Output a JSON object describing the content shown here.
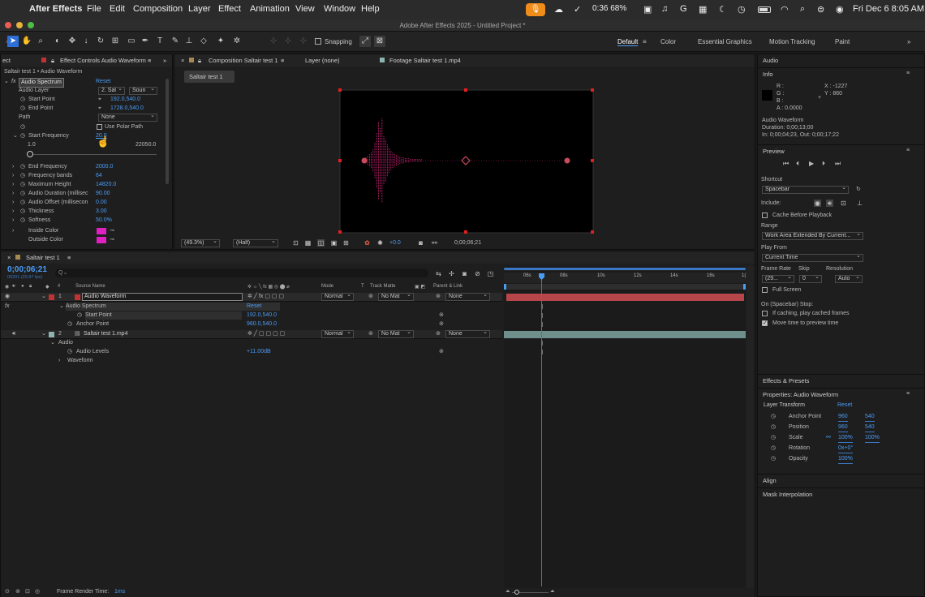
{
  "menubar": {
    "app_name": "After Effects",
    "menus": [
      "File",
      "Edit",
      "Composition",
      "Layer",
      "Effect",
      "Animation",
      "View",
      "Window",
      "Help"
    ],
    "battery_status": "0:36 68%",
    "clock": "Fri Dec 6  8:05 AM"
  },
  "window_title": "Adobe After Effects 2025 - Untitled Project *",
  "toolbar": {
    "snapping_label": "Snapping",
    "workspaces": [
      "Default",
      "Color",
      "Essential Graphics",
      "Motion Tracking",
      "Paint"
    ],
    "active_workspace": "Default"
  },
  "effect_controls": {
    "panel_tab_prefix": "ect",
    "title": "Effect Controls Audio Waveform",
    "breadcrumb": "Saltair test 1 • Audio Waveform",
    "effect_name": "Audio Spectrum",
    "reset_label": "Reset",
    "audio_layer_label": "Audio Layer",
    "audio_layer_value": "2. Sal",
    "audio_source_value": "Soun",
    "start_point_label": "Start Point",
    "start_point_value": "192.0,540.0",
    "end_point_label": "End Point",
    "end_point_value": "1728.0,540.0",
    "path_label": "Path",
    "path_value": "None",
    "use_polar_path_label": "Use Polar Path",
    "start_frequency_label": "Start Frequency",
    "start_frequency_value": "20.0",
    "slider_min": "1.0",
    "slider_max": "22050.0",
    "props": [
      {
        "label": "End Frequency",
        "value": "2000.0"
      },
      {
        "label": "Frequency bands",
        "value": "64"
      },
      {
        "label": "Maximum Height",
        "value": "14820.0"
      },
      {
        "label": "Audio Duration (millisec",
        "value": "90.00"
      },
      {
        "label": "Audio Offset (millisecon",
        "value": "0.00"
      },
      {
        "label": "Thickness",
        "value": "3.00"
      },
      {
        "label": "Softness",
        "value": "50.0%"
      }
    ],
    "inside_color_label": "Inside Color",
    "outside_color_label": "Outside Color",
    "color_swatch": "#e020c0"
  },
  "composition_panel": {
    "tab_title": "Composition Saltair test 1",
    "layer_tab": "Layer (none)",
    "footage_tab": "Footage Saltair test 1.mp4",
    "comp_chip": "Saltair test 1",
    "zoom": "(49.3%)",
    "resolution": "(Half)",
    "exposure": "+0.0",
    "timecode": "0;00;06;21",
    "waveform_color": "#c2206e",
    "handle_color": "#e02020"
  },
  "timeline": {
    "tab_title": "Saltair test 1",
    "timecode": "0;00;06;21",
    "fps_note": "00201 (29.97 fps)",
    "search_placeholder": "Q⌄",
    "headers": {
      "num": "#",
      "source": "Source Name",
      "mode": "Mode",
      "t": "T",
      "track_matte": "Track Matte",
      "parent": "Parent & Link"
    },
    "ruler": [
      "06s",
      "08s",
      "10s",
      "12s",
      "14s",
      "16s",
      "1("
    ],
    "layer1": {
      "num": "1",
      "name": "Audio Waveform",
      "mode": "Normal",
      "matte": "No Mat",
      "parent": "None",
      "color": "#c23232"
    },
    "effect_group": "Audio Spectrum",
    "effect_reset": "Reset",
    "start_point_label": "Start Point",
    "start_point_value": "192.0,540.0",
    "anchor_point_label": "Anchor Point",
    "anchor_point_value": "960.0,540.0",
    "layer2": {
      "num": "2",
      "name": "Saltair test 1.mp4",
      "mode": "Normal",
      "matte": "No Mat",
      "parent": "None",
      "color": "#6f8f8c"
    },
    "audio_group": "Audio",
    "audio_levels_label": "Audio Levels",
    "audio_levels_value": "+11.00dB",
    "waveform_group": "Waveform",
    "render_time_label": "Frame Render Time:",
    "render_time_value": "1ms"
  },
  "right_panel": {
    "audio_title": "Audio",
    "info_title": "Info",
    "info_r": "R :",
    "info_g": "G :",
    "info_b": "B :",
    "info_a": "A :  0.0000",
    "info_x": "X : -1227",
    "info_y": "Y :  860",
    "info_name": "Audio Waveform",
    "info_duration": "Duration: 0;00;13;00",
    "info_inout": "In: 0;00;04;23, Out: 0;00;17;22",
    "preview_title": "Preview",
    "shortcut_label": "Shortcut",
    "shortcut_value": "Spacebar",
    "include_label": "Include:",
    "cache_label": "Cache Before Playback",
    "range_label": "Range",
    "range_value": "Work Area Extended By Current...",
    "play_from_label": "Play From",
    "play_from_value": "Current Time",
    "frame_rate_label": "Frame Rate",
    "frame_rate_value": "(29...",
    "skip_label": "Skip",
    "skip_value": "0",
    "resolution_label": "Resolution",
    "resolution_value": "Auto",
    "full_screen_label": "Full Screen",
    "on_stop_label": "On (Spacebar) Stop:",
    "if_caching_label": "If caching, play cached frames",
    "move_time_label": "Move time to preview time",
    "effects_presets": "Effects & Presets",
    "properties_title": "Properties: Audio Waveform",
    "layer_transform": "Layer Transform",
    "reset_label": "Reset",
    "transform": [
      {
        "label": "Anchor Point",
        "v1": "960",
        "v2": "540"
      },
      {
        "label": "Position",
        "v1": "960",
        "v2": "540"
      },
      {
        "label": "Scale",
        "v1": "100%",
        "v2": "100%"
      },
      {
        "label": "Rotation",
        "v1": "0x+0°",
        "v2": ""
      },
      {
        "label": "Opacity",
        "v1": "100%",
        "v2": ""
      }
    ],
    "align": "Align",
    "mask_interpolation": "Mask Interpolation"
  }
}
